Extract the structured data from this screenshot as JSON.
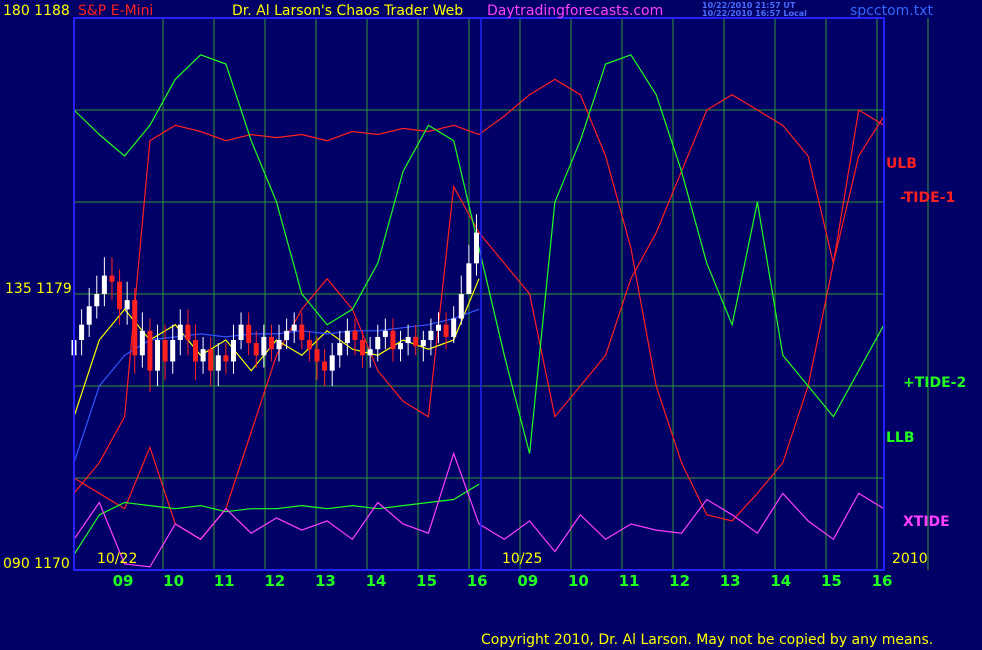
{
  "header": {
    "left_id": "180  1188",
    "symbol": "S&P E-Mini",
    "title": "Dr. Al Larson's Chaos Trader Web",
    "site": "Daytradingforecasts.com",
    "time_utc": "10/22/2010 21:57 UT",
    "time_local": "10/22/2010 16:57 Local",
    "file": "spcctom.txt"
  },
  "y_axis_labels": {
    "top": "180  1188",
    "mid": "135  1179",
    "bottom": "090  1170"
  },
  "date_labels": {
    "left": "10/22",
    "middle": "10/25",
    "right": "2010"
  },
  "series_labels": {
    "ulb": "ULB",
    "tide1": "-TIDE-1",
    "tide2": "+TIDE-2",
    "llb": "LLB",
    "xtide": "XTIDE"
  },
  "footer": {
    "copyright": "Copyright 2010, Dr. Al Larson. May not be copied by any means."
  },
  "colors": {
    "background": "#000066",
    "grid": "#339933",
    "frame": "#2222ff",
    "red_series": "#ff2020",
    "green_series": "#20ff20",
    "magenta_series": "#ff40ff",
    "blue_series": "#3355ff",
    "yellow_series": "#ffff00",
    "up_bar": "#ffffff",
    "down_bar": "#ff2020"
  },
  "chart_data": {
    "type": "line",
    "x_ticks": [
      "09",
      "10",
      "11",
      "12",
      "13",
      "14",
      "15",
      "16",
      "09",
      "10",
      "11",
      "12",
      "13",
      "14",
      "15",
      "16"
    ],
    "y_range": [
      1170,
      1188
    ],
    "y_ticks": [
      1170,
      1179,
      1188
    ],
    "grid": true,
    "series": [
      {
        "name": "ULB",
        "color": "#ff2020",
        "x": [
          0,
          0.5,
          1,
          1.5,
          2,
          2.5,
          3,
          3.5,
          4,
          4.5,
          5,
          5.5,
          6,
          6.5,
          7,
          7.5,
          8,
          8.5,
          9,
          9.5,
          10,
          10.5,
          11,
          11.5,
          12,
          12.5,
          13,
          13.5,
          14,
          14.5,
          15,
          15.5,
          16
        ],
        "y": [
          1172.5,
          1173.5,
          1175,
          1184,
          1184.5,
          1184.3,
          1184,
          1184.2,
          1184.1,
          1184.2,
          1184,
          1184.3,
          1184.2,
          1184.4,
          1184.3,
          1184.5,
          1184.2,
          1184.8,
          1185.5,
          1186,
          1185.5,
          1183.5,
          1180.5,
          1176,
          1173.5,
          1171.8,
          1171.6,
          1172.5,
          1173.5,
          1176,
          1180,
          1183.5,
          1184.8
        ]
      },
      {
        "name": "-TIDE-1",
        "color": "#ff2020",
        "x": [
          0,
          0.5,
          1,
          1.5,
          2,
          2.5,
          3,
          3.5,
          4,
          4.5,
          5,
          5.5,
          6,
          6.5,
          7,
          7.5,
          8,
          8.5,
          9,
          9.5,
          10,
          10.5,
          11,
          11.5,
          12,
          12.5,
          13,
          13.5,
          14,
          14.5,
          15,
          15.5,
          16
        ],
        "y": [
          1173,
          1172.5,
          1172,
          1174,
          1171.5,
          1171,
          1172,
          1174.5,
          1177,
          1178.5,
          1179.5,
          1178.5,
          1176.5,
          1175.5,
          1175,
          1182.5,
          1181,
          1180,
          1179,
          1175,
          1176,
          1177,
          1179.5,
          1181,
          1183,
          1185,
          1185.5,
          1185,
          1184.5,
          1183.5,
          1180,
          1185,
          1184.5
        ]
      },
      {
        "name": "+TIDE-2",
        "color": "#20ff20",
        "x": [
          0,
          0.5,
          1,
          1.5,
          2,
          2.5,
          3,
          3.5,
          4,
          4.5,
          5,
          5.5,
          6,
          6.5,
          7,
          7.5,
          8,
          8.5,
          9,
          9.5,
          10,
          10.5,
          11,
          11.5,
          12,
          12.5,
          13,
          13.5,
          14,
          14.5,
          15,
          15.5,
          16
        ],
        "y": [
          1185,
          1184.2,
          1183.5,
          1184.5,
          1186,
          1186.8,
          1186.5,
          1184,
          1182,
          1179,
          1178,
          1178.5,
          1180,
          1183,
          1184.5,
          1184,
          1180.5,
          1177,
          1173.8,
          1182,
          1184,
          1186.5,
          1186.8,
          1185.5,
          1183,
          1180,
          1178,
          1182,
          1177,
          1176,
          1175,
          1176.5,
          1178
        ]
      },
      {
        "name": "LLB",
        "color": "#20ff20",
        "x": [
          0,
          0.5,
          1,
          1.5,
          2,
          2.5,
          3,
          3.5,
          4,
          4.5,
          5,
          5.5,
          6,
          6.5,
          7,
          7.5,
          8
        ],
        "y": [
          1170.5,
          1171.8,
          1172.2,
          1172.1,
          1172,
          1172.1,
          1171.9,
          1172,
          1172,
          1172.1,
          1172,
          1172.1,
          1172,
          1172.1,
          1172.2,
          1172.3,
          1172.8
        ]
      },
      {
        "name": "XTIDE",
        "color": "#ff40ff",
        "x": [
          0,
          0.5,
          1,
          1.5,
          2,
          2.5,
          3,
          3.5,
          4,
          4.5,
          5,
          5.5,
          6,
          6.5,
          7,
          7.5,
          8,
          8.5,
          9,
          9.5,
          10,
          10.5,
          11,
          11.5,
          12,
          12.5,
          13,
          13.5,
          14,
          14.5,
          15,
          15.5,
          16
        ],
        "y": [
          1171,
          1172.2,
          1170.2,
          1170.1,
          1171.5,
          1171,
          1172,
          1171.2,
          1171.7,
          1171.3,
          1171.6,
          1171,
          1172.2,
          1171.5,
          1171.2,
          1173.8,
          1171.5,
          1171,
          1171.6,
          1170.6,
          1171.8,
          1171,
          1171.5,
          1171.3,
          1171.2,
          1172.3,
          1171.8,
          1171.2,
          1172.5,
          1171.6,
          1171,
          1172.5,
          1172
        ]
      },
      {
        "name": "",
        "color": "#ffff00",
        "x": [
          0,
          0.5,
          1,
          1.5,
          2,
          2.5,
          3,
          3.5,
          4,
          4.5,
          5,
          5.5,
          6,
          6.5,
          7,
          7.5,
          8
        ],
        "y": [
          1175,
          1177.5,
          1178.5,
          1177.5,
          1178,
          1177,
          1177.5,
          1176.5,
          1177.5,
          1177,
          1177.8,
          1177.2,
          1177,
          1177.5,
          1177.2,
          1177.5,
          1179.5
        ]
      },
      {
        "name": "",
        "color": "#3355ff",
        "x": [
          0,
          0.5,
          1,
          1.5,
          2,
          2.5,
          3,
          3.5,
          4,
          4.5,
          5,
          5.5,
          6,
          6.5,
          7,
          7.5,
          8
        ],
        "y": [
          1173.5,
          1176,
          1177,
          1177.5,
          1177.6,
          1177.7,
          1177.6,
          1177.7,
          1177.7,
          1177.8,
          1177.7,
          1177.8,
          1177.8,
          1177.9,
          1178,
          1178.2,
          1178.5
        ]
      }
    ],
    "price_bars": {
      "x": [
        0,
        0.15,
        0.3,
        0.45,
        0.6,
        0.75,
        0.9,
        1.05,
        1.2,
        1.35,
        1.5,
        1.65,
        1.8,
        1.95,
        2.1,
        2.25,
        2.4,
        2.55,
        2.7,
        2.85,
        3,
        3.15,
        3.3,
        3.45,
        3.6,
        3.75,
        3.9,
        4.05,
        4.2,
        4.35,
        4.5,
        4.65,
        4.8,
        4.95,
        5.1,
        5.25,
        5.4,
        5.55,
        5.7,
        5.85,
        6,
        6.15,
        6.3,
        6.45,
        6.6,
        6.75,
        6.9,
        7.05,
        7.2,
        7.35,
        7.5,
        7.65,
        7.8,
        7.95
      ],
      "open": [
        1177,
        1177.5,
        1178,
        1178.6,
        1179,
        1179.6,
        1179.4,
        1178.5,
        1178.8,
        1177,
        1177.8,
        1176.5,
        1177.5,
        1176.8,
        1177.5,
        1178,
        1177.5,
        1176.8,
        1177.2,
        1176.5,
        1177,
        1176.8,
        1177.5,
        1178,
        1177.4,
        1177,
        1177.6,
        1177.2,
        1177.5,
        1177.8,
        1178,
        1177.5,
        1177.2,
        1176.8,
        1176.5,
        1177,
        1177.4,
        1177.8,
        1177.5,
        1177,
        1177.2,
        1177.6,
        1177.8,
        1177.2,
        1177.4,
        1177.6,
        1177.3,
        1177.5,
        1177.8,
        1178,
        1177.6,
        1178.2,
        1179,
        1180
      ],
      "close": [
        1177.5,
        1178,
        1178.6,
        1179,
        1179.6,
        1179.4,
        1178.5,
        1178.8,
        1177,
        1177.8,
        1176.5,
        1177.5,
        1176.8,
        1177.5,
        1178,
        1177.5,
        1176.8,
        1177.2,
        1176.5,
        1177,
        1176.8,
        1177.5,
        1178,
        1177.4,
        1177,
        1177.6,
        1177.2,
        1177.5,
        1177.8,
        1178,
        1177.5,
        1177.2,
        1176.8,
        1176.5,
        1177,
        1177.4,
        1177.8,
        1177.5,
        1177,
        1177.2,
        1177.6,
        1177.8,
        1177.2,
        1177.4,
        1177.6,
        1177.3,
        1177.5,
        1177.8,
        1178,
        1177.6,
        1178.2,
        1179,
        1180,
        1181
      ],
      "high": [
        1178,
        1178.5,
        1179.2,
        1179.6,
        1180.2,
        1180.2,
        1179.8,
        1179.4,
        1179.2,
        1178.4,
        1178.2,
        1178,
        1178,
        1178,
        1178.5,
        1178.5,
        1178,
        1177.6,
        1177.6,
        1177.4,
        1177.4,
        1178,
        1178.4,
        1178.4,
        1177.8,
        1178,
        1178,
        1178,
        1178.2,
        1178.4,
        1178.4,
        1177.8,
        1177.6,
        1177.2,
        1177.4,
        1177.8,
        1178.2,
        1178.2,
        1177.8,
        1177.6,
        1178,
        1178.2,
        1178.2,
        1177.8,
        1178,
        1178,
        1177.8,
        1178.2,
        1178.4,
        1178.4,
        1178.6,
        1179.6,
        1180.6,
        1181.6
      ],
      "low": [
        1176.6,
        1177,
        1177.6,
        1178.2,
        1178.6,
        1178.8,
        1178,
        1178,
        1176.4,
        1176.6,
        1175.8,
        1176,
        1176.2,
        1176.4,
        1177,
        1177,
        1176.2,
        1176.4,
        1176,
        1176,
        1176.4,
        1176.4,
        1177.2,
        1177,
        1176.6,
        1176.6,
        1176.8,
        1176.8,
        1177.2,
        1177.4,
        1177.2,
        1176.8,
        1176.2,
        1176,
        1176,
        1176.6,
        1177,
        1177,
        1176.6,
        1176.6,
        1176.8,
        1177.2,
        1176.8,
        1176.8,
        1177,
        1177,
        1176.8,
        1177,
        1177.4,
        1177.2,
        1177.4,
        1178,
        1179,
        1179.6
      ]
    }
  }
}
